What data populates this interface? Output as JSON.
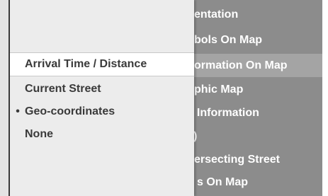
{
  "background_menu": {
    "items": [
      {
        "label": "entation"
      },
      {
        "label": "bols On Map"
      },
      {
        "label": "ormation On Map",
        "selected": true
      },
      {
        "label": "phic Map"
      },
      {
        "label": "/ Information"
      },
      {
        "label": ")"
      },
      {
        "label": "ersecting Street"
      },
      {
        "label": "s On Map"
      }
    ]
  },
  "popup_menu": {
    "items": [
      {
        "label": "Arrival Time / Distance",
        "selected": true,
        "bullet": ""
      },
      {
        "label": "Current Street",
        "selected": false,
        "bullet": ""
      },
      {
        "label": "Geo-coordinates",
        "selected": false,
        "bullet": "•"
      },
      {
        "label": "None",
        "selected": false,
        "bullet": ""
      }
    ]
  },
  "colors": {
    "popup_bg": "#ececec",
    "background_menu_bg": "#8c8c8c",
    "text_dark": "#3a3a3a",
    "text_light": "#ffffff"
  }
}
